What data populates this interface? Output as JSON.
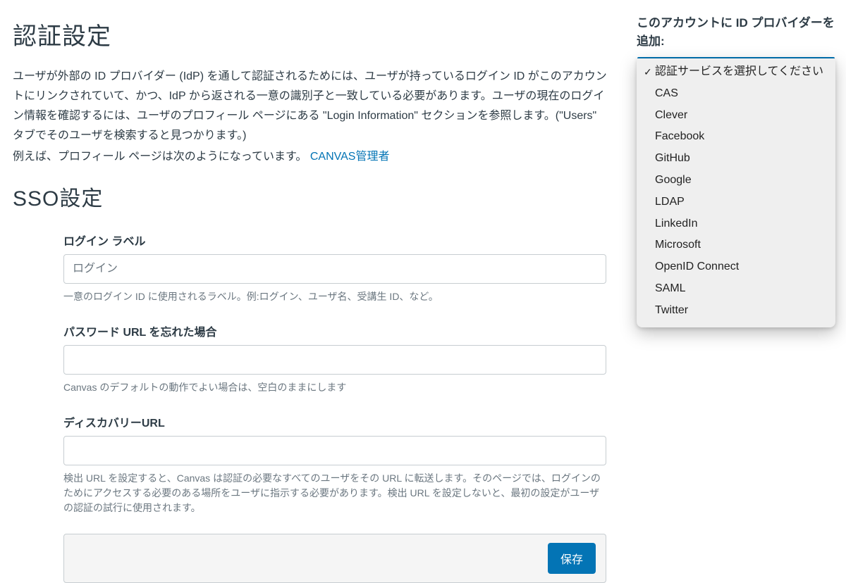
{
  "page": {
    "title": "認証設定",
    "intro_line1": "ユーザが外部の ID プロバイダー (IdP) を通して認証されるためには、ユーザが持っているログイン ID がこのアカウントにリンクされていて、かつ、IdP から返される一意の識別子と一致している必要があります。ユーザの現在のログイン情報を確認するには、ユーザのプロフィール ページにある \"Login Information\" セクションを参照します。(\"Users\" タブでそのユーザを検索すると見つかります。)",
    "intro_line2_prefix": "例えば、プロフィール ページは次のようになっています。 ",
    "intro_link_text": "CANVAS管理者",
    "sso_title": "SSO設定"
  },
  "form": {
    "login_label_title": "ログイン ラベル",
    "login_label_placeholder": "ログイン",
    "login_label_help": "一意のログイン ID に使用されるラベル。例:ログイン、ユーザ名、受講生 ID、など。",
    "password_url_title": "パスワード URL を忘れた場合",
    "password_url_help": "Canvas のデフォルトの動作でよい場合は、空白のままにします",
    "discovery_url_title": "ディスカバリーURL",
    "discovery_url_help": "検出 URL を設定すると、Canvas は認証の必要なすべてのユーザをその URL に転送します。そのページでは、ログインのためにアクセスする必要のある場所をユーザに指示する必要があります。検出 URL を設定しないと、最初の設定がユーザの認証の試行に使用されます。",
    "save_button": "保存"
  },
  "sidebar": {
    "title": "このアカウントに ID プロバイダーを追加:",
    "options": [
      "認証サービスを選択してください",
      "CAS",
      "Clever",
      "Facebook",
      "GitHub",
      "Google",
      "LDAP",
      "LinkedIn",
      "Microsoft",
      "OpenID Connect",
      "SAML",
      "Twitter"
    ],
    "selected_index": 0
  }
}
